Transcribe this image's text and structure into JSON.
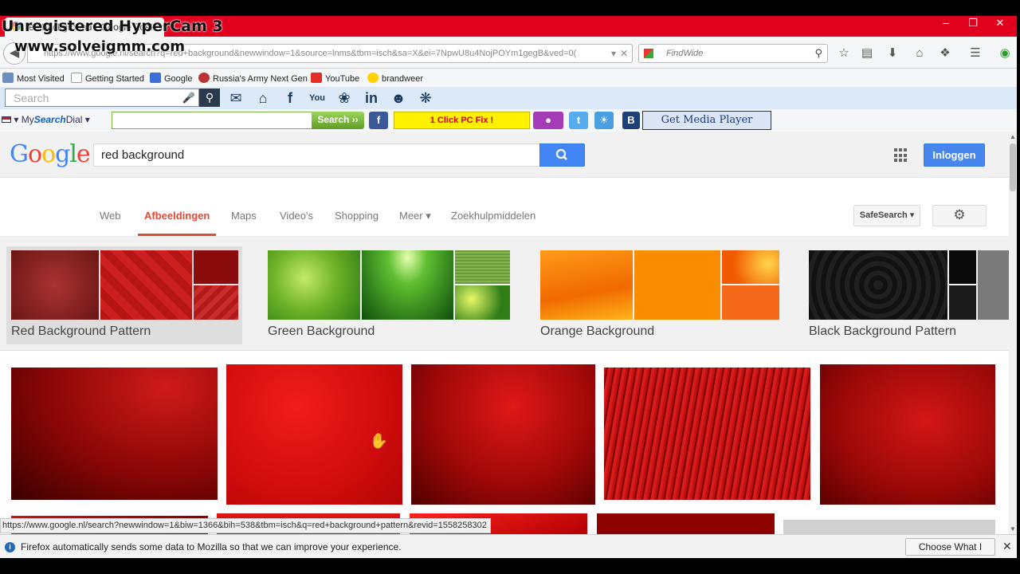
{
  "window": {
    "tab_title": "red background - Google Zoeken",
    "minimize": "–",
    "maximize": "❐",
    "close": "✕"
  },
  "watermark": {
    "line1": "Unregistered HyperCam 3",
    "line2": "www.solveigmm.com"
  },
  "nav": {
    "url": "https://www.google.nl/search?q=red+background&newwindow=1&source=lnms&tbm=isch&sa=X&ei=7NpwU8u4NojPOYm1gegB&ved=0(",
    "search_placeholder": "FindWide"
  },
  "bookmarks": [
    {
      "label": "Most Visited"
    },
    {
      "label": "Getting Started"
    },
    {
      "label": "Google"
    },
    {
      "label": "Russia's Army Next Gen"
    },
    {
      "label": "YouTube"
    },
    {
      "label": "brandweer"
    }
  ],
  "toolbar1": {
    "search_placeholder": "Search"
  },
  "toolbar2": {
    "my": "My",
    "search": "Search",
    "dial": "Dial",
    "search_btn": "Search ››",
    "pcfix": "1 Click PC Fix !",
    "media_plugin": "Get Media Player Plugin"
  },
  "google": {
    "query": "red background",
    "login": "Inloggen",
    "tabs": [
      "Web",
      "Afbeeldingen",
      "Maps",
      "Video's",
      "Shopping",
      "Meer ▾",
      "Zoekhulpmiddelen"
    ],
    "safesearch": "SafeSearch ▾",
    "related": [
      {
        "label": "Red Background Pattern"
      },
      {
        "label": "Green Background"
      },
      {
        "label": "Orange Background"
      },
      {
        "label": "Black Background Pattern"
      }
    ]
  },
  "status_url": "https://www.google.nl/search?newwindow=1&biw=1366&bih=538&tbm=isch&q=red+background+pattern&revid=1558258302",
  "infobar": {
    "text": "Firefox automatically sends some data to Mozilla so that we can improve your experience.",
    "button": "Choose What I Share"
  },
  "colors": {
    "google_blue": "#4285f4",
    "active_tab": "#dd4b39",
    "titlebar": "#e1001e"
  }
}
